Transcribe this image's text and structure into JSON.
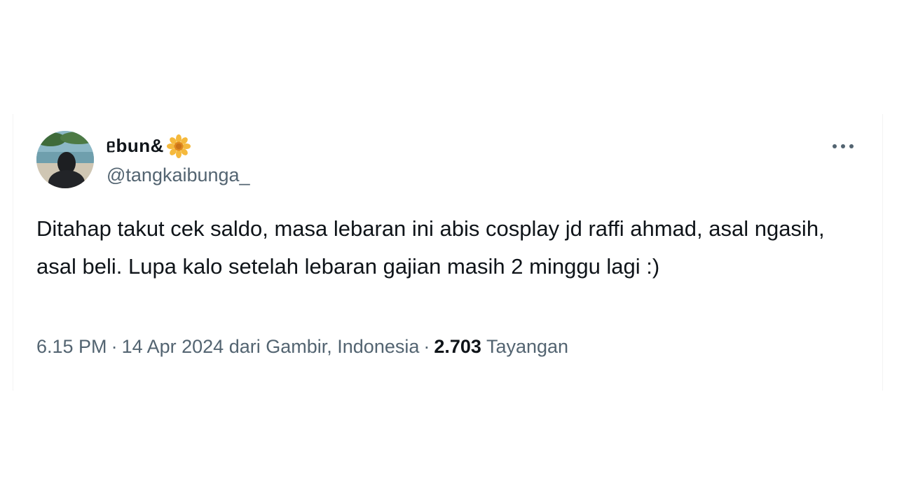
{
  "tweet": {
    "display_name": "ᥱbun&",
    "name_emoji": "sunflower-icon",
    "handle": "@tangkaibunga_",
    "text": "Ditahap takut cek saldo, masa lebaran ini abis cosplay jd raffi ahmad, asal ngasih, asal beli. Lupa kalo setelah lebaran gajian masih 2 minggu lagi :)",
    "time": "6.15 PM",
    "separator": "·",
    "date": "14 Apr 2024",
    "location": "dari Gambir, Indonesia",
    "views_count": "2.703",
    "views_label": "Tayangan"
  },
  "icons": {
    "more": "more-horizontal-icon",
    "avatar": "profile-avatar"
  },
  "colors": {
    "text_primary": "#0f1419",
    "text_secondary": "#536471",
    "emoji_petals": "#f5b93c"
  }
}
